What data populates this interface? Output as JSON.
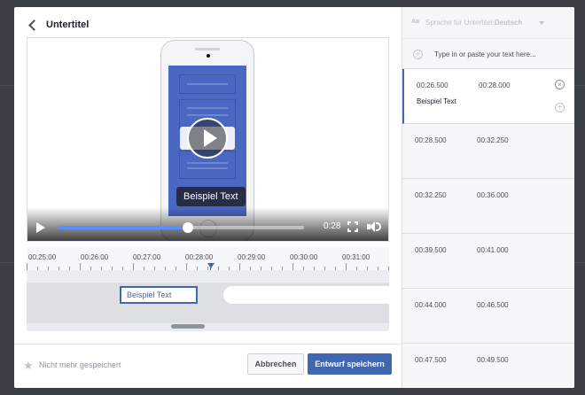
{
  "header": {
    "title": "Untertitel"
  },
  "video": {
    "caption_overlay": "Beispiel Text",
    "time": "0:28",
    "progress_fraction": 0.53
  },
  "timeline": {
    "ticks": [
      "00:25:00",
      "00:26:00",
      "00:27:00",
      "00:28:00",
      "00:29:00",
      "00:30:00",
      "00:31:00"
    ],
    "segment_label": "Beispiel Text"
  },
  "footer": {
    "status": "Nicht mehr gespeichert",
    "cancel_label": "Abbrechen",
    "save_label": "Entwurf speichern"
  },
  "sidebar": {
    "language_prefix": "Sprache für Untertitel:",
    "language_value": "Deutsch",
    "language_icon_text": "Aa",
    "input_placeholder": "Type in or paste your text here...",
    "entries": [
      {
        "start": "00:26.500",
        "end": "00:28.000",
        "text": "Beispiel Text",
        "active": true
      },
      {
        "start": "00:28.500",
        "end": "00:32.250",
        "text": ""
      },
      {
        "start": "00:32.250",
        "end": "00:36.000",
        "text": ""
      },
      {
        "start": "00:39.500",
        "end": "00:41.000",
        "text": ""
      },
      {
        "start": "00:44.000",
        "end": "00:46.500",
        "text": ""
      },
      {
        "start": "00:47.500",
        "end": "00:49.500",
        "text": ""
      }
    ]
  },
  "colors": {
    "accent": "#4267b2",
    "progress": "#5890ff",
    "phone_screen": "#4a67c2"
  },
  "icons": [
    "back-chevron-icon",
    "play-icon",
    "fullscreen-icon",
    "volume-icon",
    "star-icon",
    "add-circle-icon",
    "close-circle-icon",
    "language-icon",
    "dropdown-caret-icon"
  ]
}
